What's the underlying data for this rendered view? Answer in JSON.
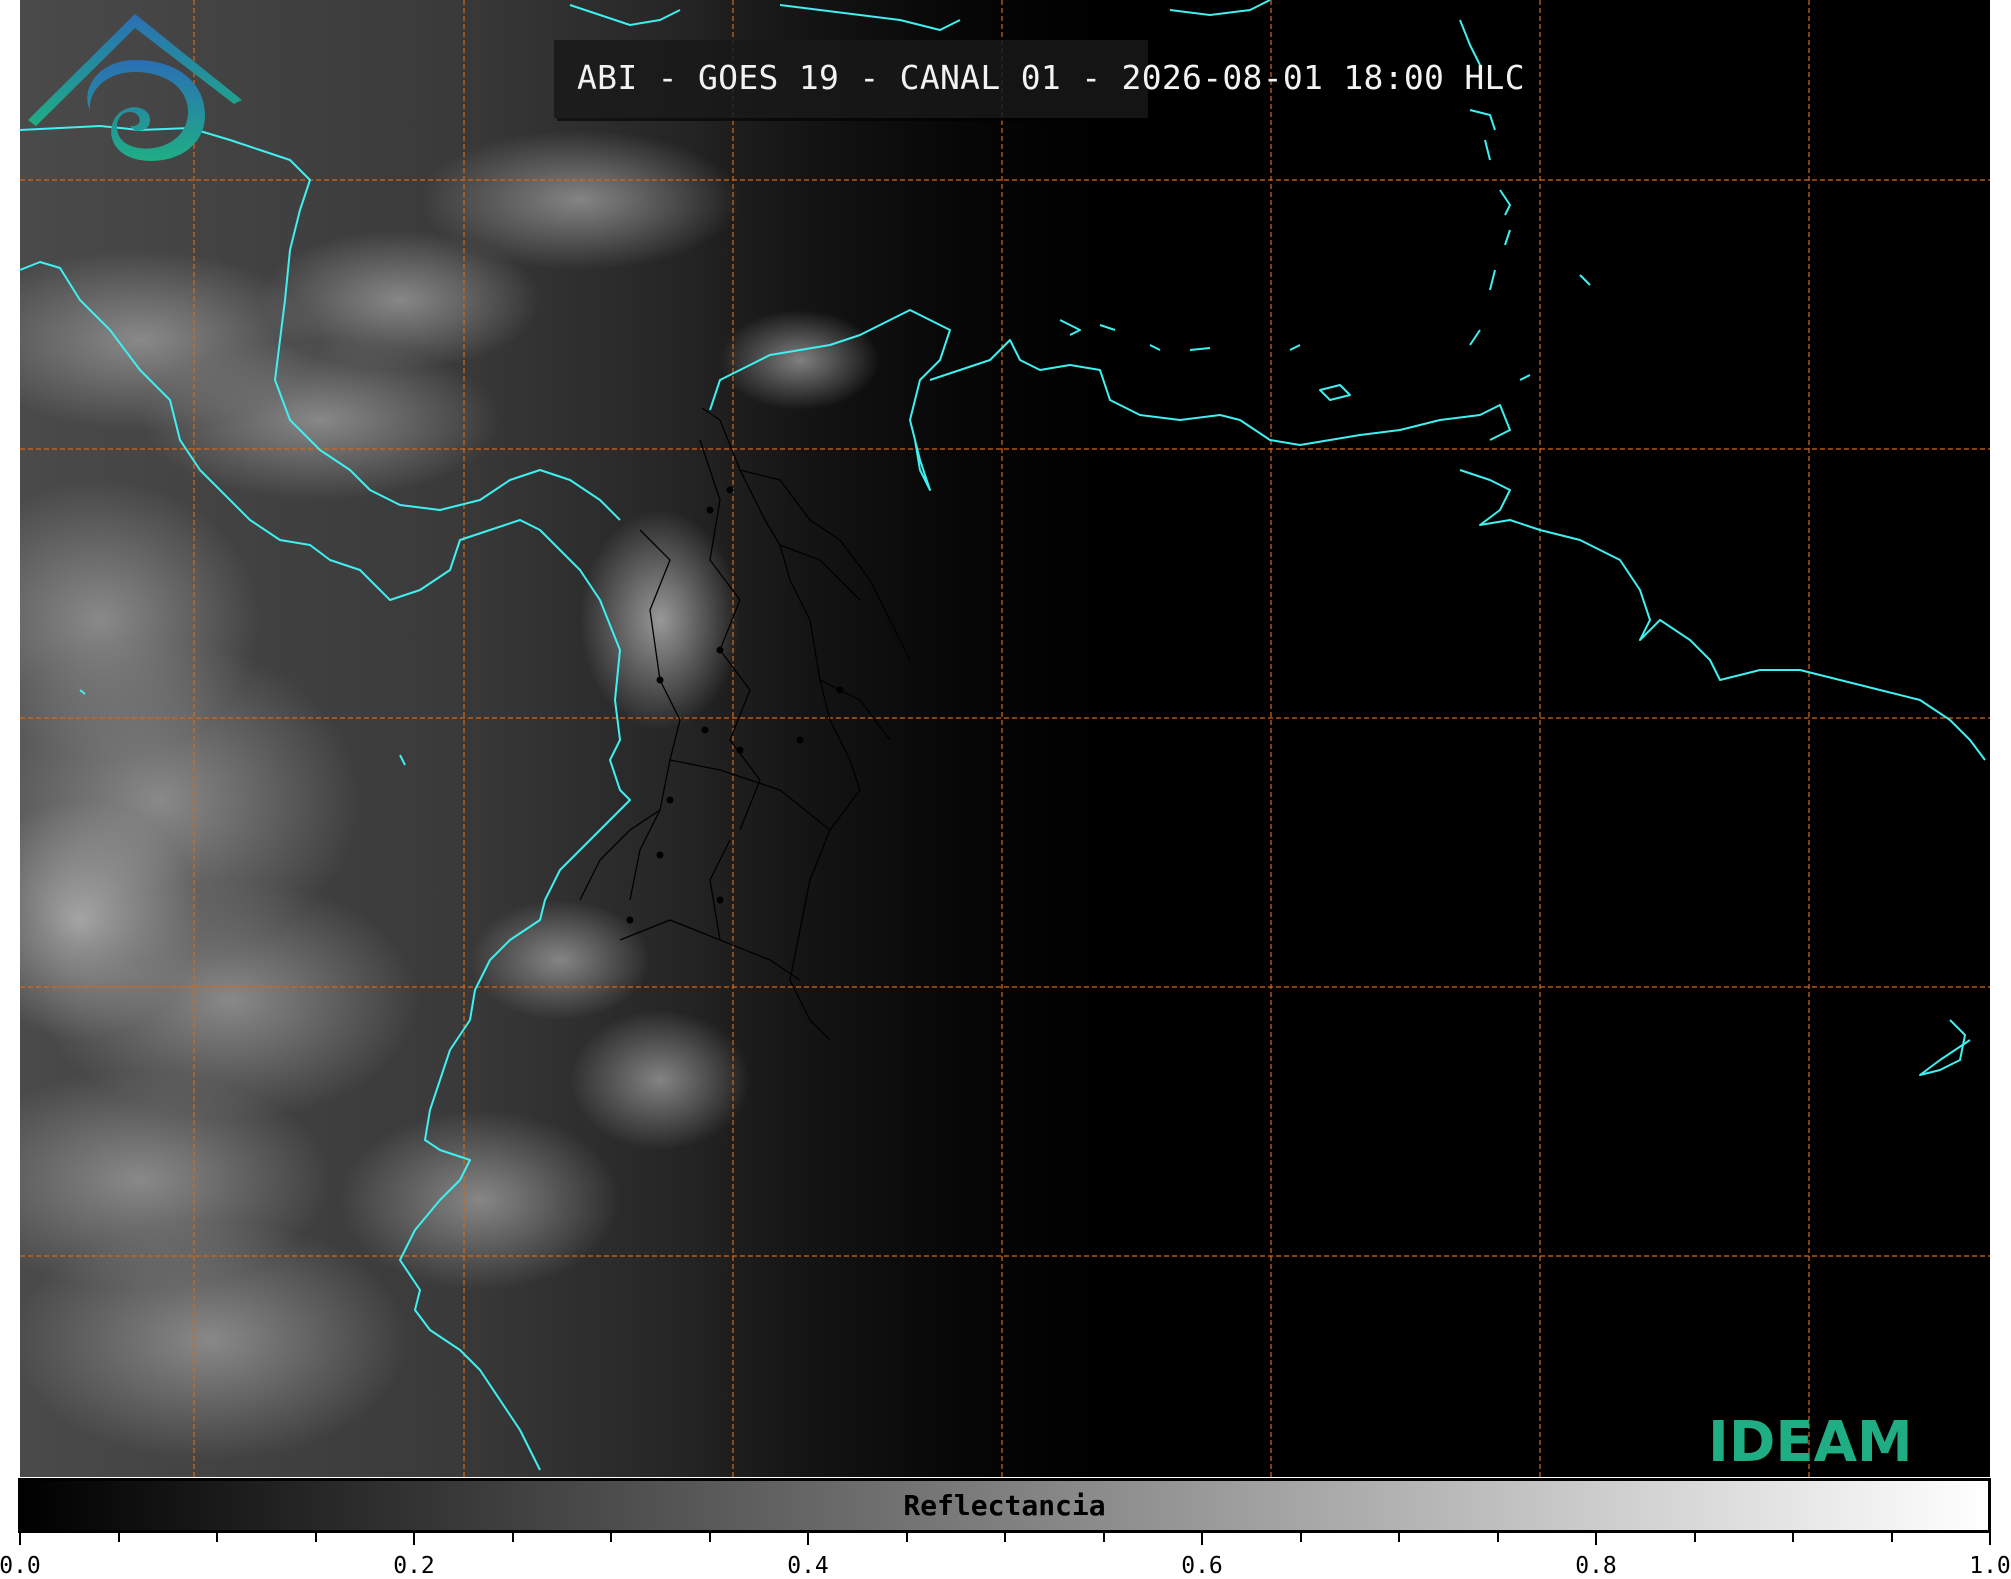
{
  "title": "ABI - GOES 19 - CANAL 01 - 2026-08-01 18:00 HLC",
  "logo": {
    "text": "IDEAM",
    "colors": {
      "blue": "#2a6fb5",
      "teal": "#1fae84"
    }
  },
  "colorbar": {
    "label": "Reflectancia",
    "ticks": [
      "0.0",
      "0.2",
      "0.4",
      "0.6",
      "0.8",
      "1.0"
    ],
    "range": [
      0.0,
      1.0
    ],
    "colormap": "grayscale (black to white)"
  },
  "map": {
    "coastline_color": "#3ff0f0",
    "gridline_color": "#d2691e",
    "gridline_style": "dashed",
    "admin_borders_color": "#000000",
    "background": "satellite visible imagery (grayscale)"
  }
}
